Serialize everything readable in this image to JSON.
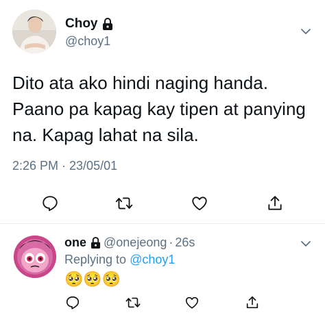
{
  "main_tweet": {
    "display_name": "Choy",
    "handle": "@choy1",
    "text_lines": [
      "Dito ata ako hindi naging handa.",
      "Paano pa kapag kay tipen at panying",
      "na. Kapag lahat na sila."
    ],
    "timestamp": "2:26 PM · 23/05/01",
    "actions": [
      "reply-icon",
      "retweet-icon",
      "like-icon",
      "share-icon"
    ]
  },
  "reply_tweet": {
    "display_name": "one",
    "handle": "@onejeong",
    "separator": "·",
    "time": "26s",
    "replying_prefix": "Replying to",
    "replying_to": "@choy1",
    "text": "🥺🥺🥺",
    "actions": [
      "reply-icon",
      "retweet-icon",
      "like-icon",
      "share-icon"
    ]
  },
  "colors": {
    "text_primary": "#0f1419",
    "text_secondary": "#5b7083",
    "link": "#1da1f2",
    "divider": "#e6ecf0"
  }
}
